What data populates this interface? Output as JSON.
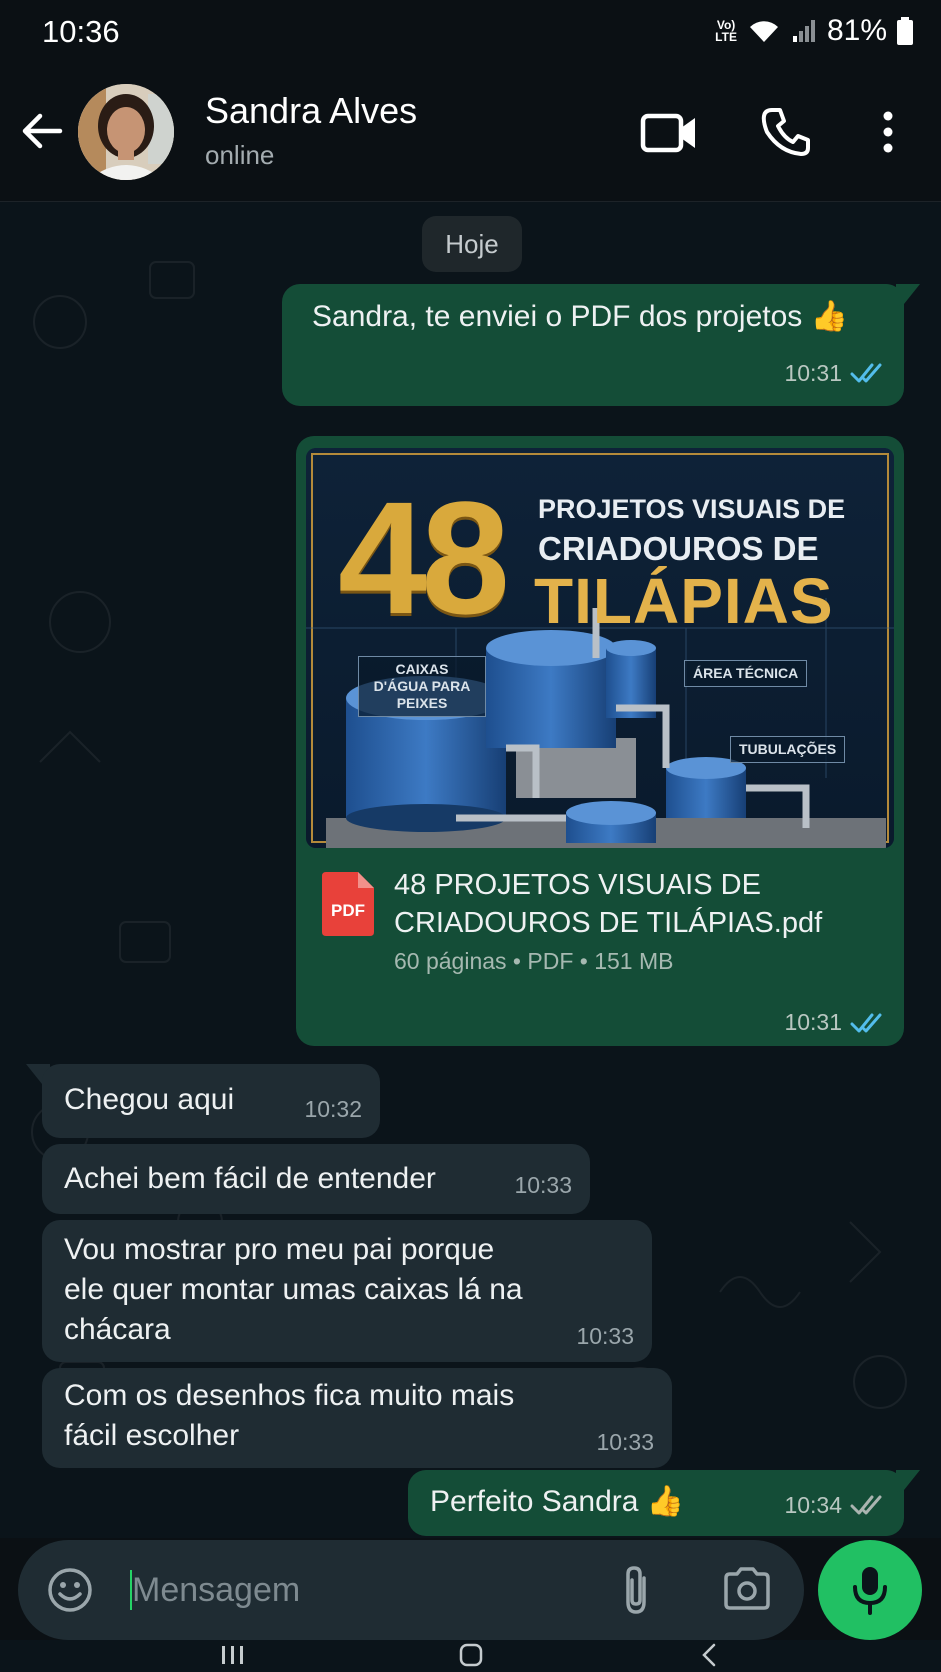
{
  "status_bar": {
    "time": "10:36",
    "volte": [
      "Vo)",
      "LTE"
    ],
    "battery": "81%"
  },
  "header": {
    "contact_name": "Sandra Alves",
    "contact_status": "online"
  },
  "chat": {
    "day_label": "Hoje",
    "messages": [
      {
        "dir": "out",
        "text": "Sandra, te enviei o PDF dos projetos 👍",
        "time": "10:31",
        "status": "read"
      },
      {
        "dir": "out",
        "type": "document",
        "cover": {
          "number": "48",
          "line1": "PROJETOS VISUAIS DE",
          "line2": "CRIADOUROS DE",
          "line3": "TILÁPIAS",
          "label_tanks": "CAIXAS D'ÁGUA PARA PEIXES",
          "label_area": "ÁREA TÉCNICA",
          "label_pipes": "TUBULAÇÕES"
        },
        "pdf_badge": "PDF",
        "file_name": "48 PROJETOS VISUAIS DE CRIADOUROS DE TILÁPIAS.pdf",
        "details": "60 páginas • PDF • 151 MB",
        "time": "10:31",
        "status": "read"
      },
      {
        "dir": "in",
        "text": "Chegou aqui",
        "time": "10:32"
      },
      {
        "dir": "in",
        "text": "Achei bem fácil de entender",
        "time": "10:33"
      },
      {
        "dir": "in",
        "text": "Vou mostrar pro meu pai porque ele quer montar umas caixas lá na chácara",
        "time": "10:33"
      },
      {
        "dir": "in",
        "text": "Com os desenhos fica muito mais fácil escolher",
        "time": "10:33"
      },
      {
        "dir": "out",
        "text": "Perfeito Sandra 👍",
        "time": "10:34",
        "status": "delivered"
      }
    ]
  },
  "input": {
    "placeholder": "Mensagem"
  },
  "icons": [
    "back-arrow-icon",
    "video-call-icon",
    "phone-icon",
    "more-options-icon",
    "emoji-icon",
    "attach-icon",
    "camera-icon",
    "mic-icon",
    "pdf-icon",
    "read-receipt-icon"
  ],
  "colors": {
    "outgoing_bubble": "#144d37",
    "incoming_bubble": "#1f2c33",
    "read_tick": "#53bdeb",
    "mic_button": "#21c063"
  }
}
